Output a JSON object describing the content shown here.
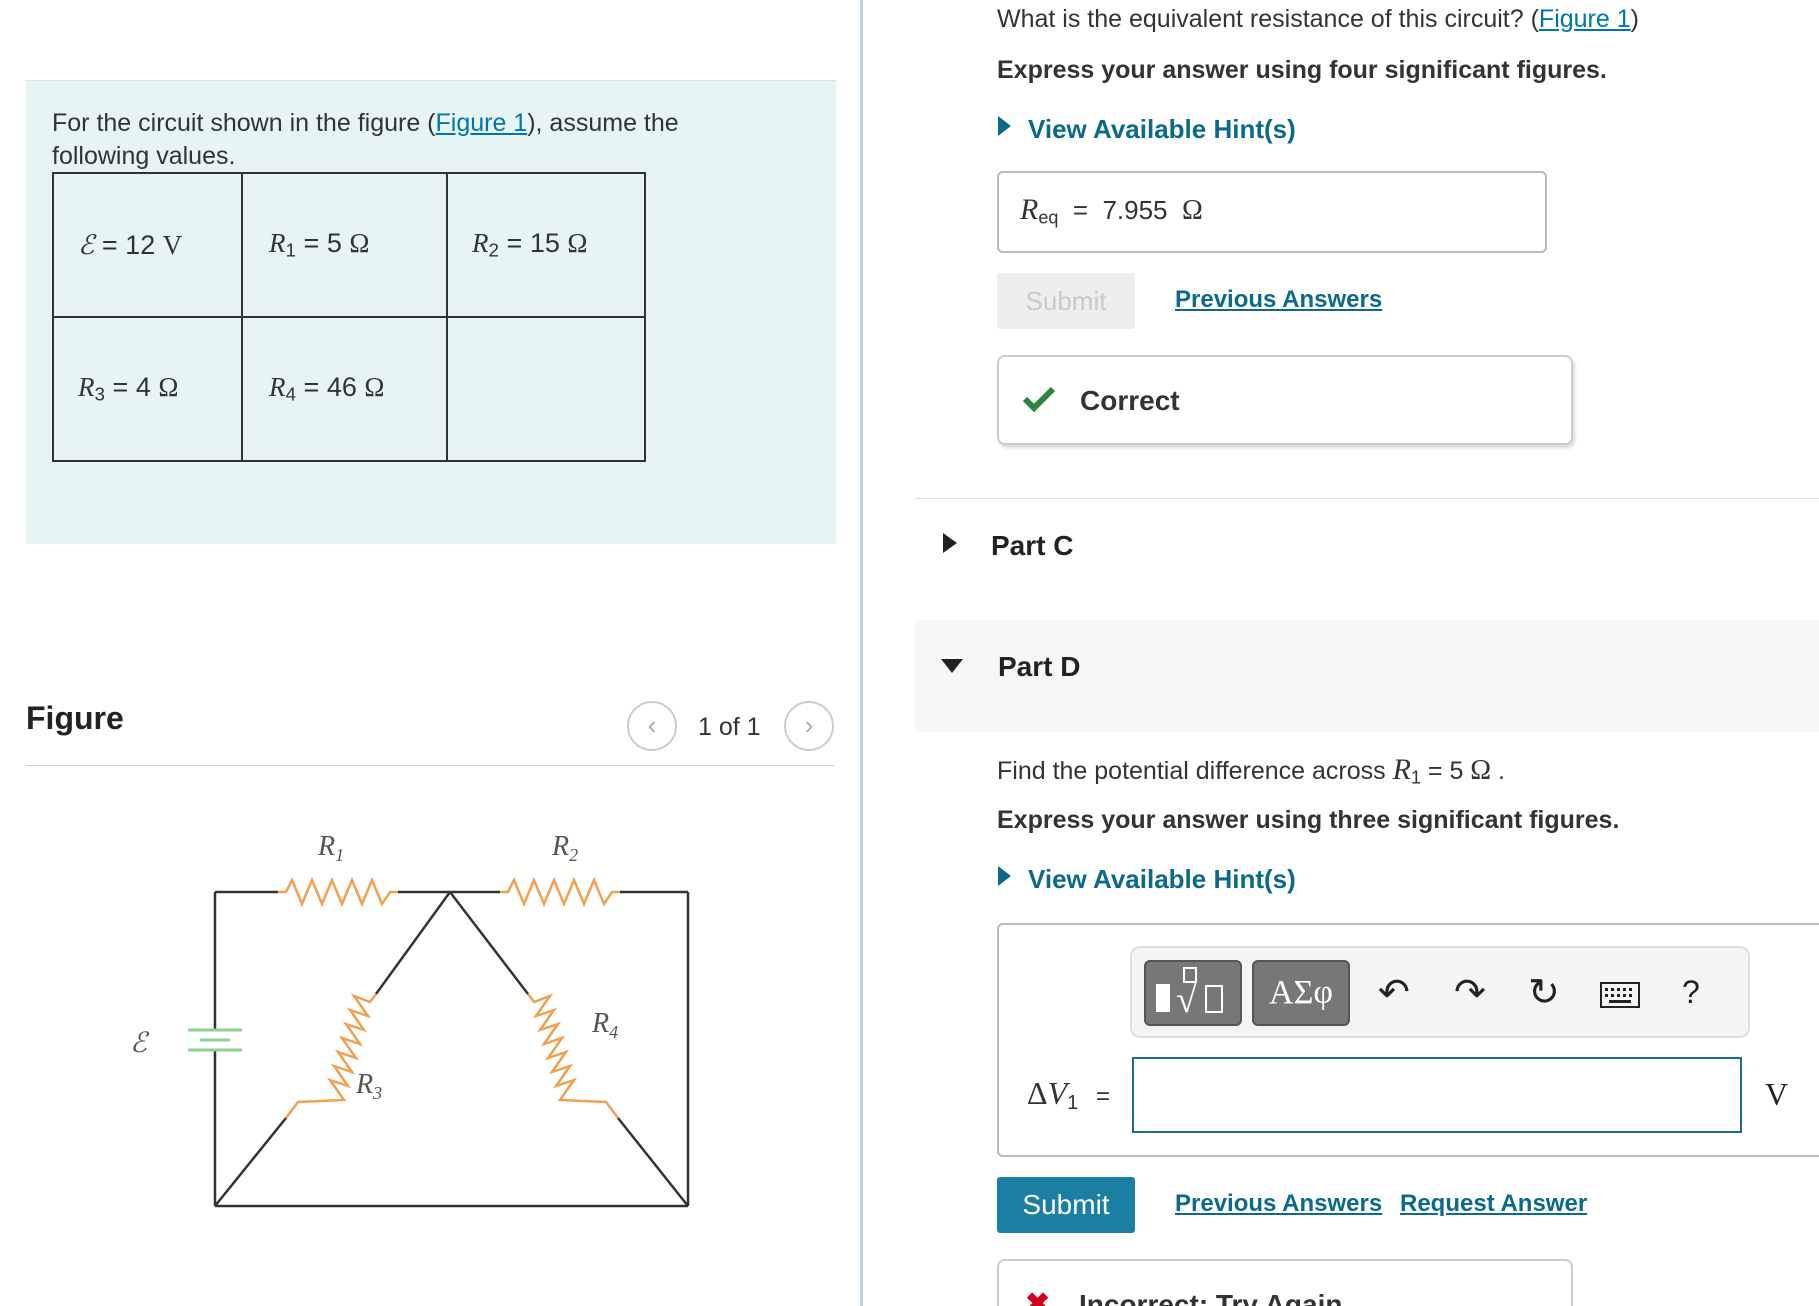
{
  "intro": {
    "text_before": "For the circuit shown in the figure (",
    "figure_link": "Figure 1",
    "text_after": "), assume the following values."
  },
  "values": {
    "emf": {
      "symbol": "ℰ",
      "value": "12",
      "unit": "V"
    },
    "r1": {
      "symbol": "R",
      "sub": "1",
      "value": "5",
      "unit": "Ω"
    },
    "r2": {
      "symbol": "R",
      "sub": "2",
      "value": "15",
      "unit": "Ω"
    },
    "r3": {
      "symbol": "R",
      "sub": "3",
      "value": "4",
      "unit": "Ω"
    },
    "r4": {
      "symbol": "R",
      "sub": "4",
      "value": "46",
      "unit": "Ω"
    },
    "equals": "="
  },
  "figure": {
    "title": "Figure",
    "pager": "1 of 1",
    "prev_icon": "chevron-left-icon",
    "next_icon": "chevron-right-icon",
    "labels": {
      "r1": "R1",
      "r2": "R2",
      "r3": "R3",
      "r4": "R4",
      "emf": "ℰ"
    },
    "colors": {
      "resistor": "#f0a050",
      "battery": "#8fd18f",
      "wire": "#333333"
    }
  },
  "part_b": {
    "question_before": "What is the equivalent resistance of this circuit?  (",
    "figure_link": "Figure 1",
    "question_after": ")",
    "instruction": "Express your answer using four significant figures.",
    "hint": "View Available Hint(s)",
    "answer_symbol": "R",
    "answer_sub": "eq",
    "equals": "=",
    "answer_value": "7.955",
    "answer_unit": "Ω",
    "submit": "Submit",
    "previous_answers": "Previous Answers",
    "feedback": "Correct",
    "feedback_color": "#2e8540"
  },
  "part_c": {
    "title": "Part C"
  },
  "part_d": {
    "title": "Part D",
    "question_before": "Find the potential difference across ",
    "question_symbol": "R",
    "question_sub": "1",
    "question_value": " = 5 ",
    "question_unit": "Ω",
    "question_after": " .",
    "instruction": "Express your answer using three significant figures.",
    "hint": "View Available Hint(s)",
    "toolbar": {
      "templates_icon": "templates-icon",
      "greek": "ΑΣφ",
      "undo_icon": "undo-icon",
      "redo_icon": "redo-icon",
      "reset_icon": "reset-icon",
      "keyboard_icon": "keyboard-icon",
      "help": "?"
    },
    "answer_label_delta": "Δ",
    "answer_label_symbol": "V",
    "answer_label_sub": "1",
    "equals": "=",
    "answer_value": "",
    "unit": "V",
    "submit": "Submit",
    "previous_answers": "Previous Answers",
    "request_answer": "Request Answer",
    "feedback": "Incorrect; Try Again",
    "feedback_color": "#d0021b",
    "accent": "#1a7fa3"
  }
}
